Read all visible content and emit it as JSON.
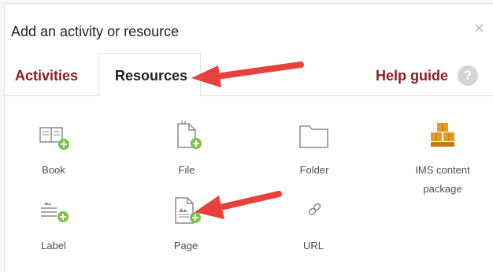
{
  "dialog": {
    "title": "Add an activity or resource",
    "close_symbol": "×"
  },
  "tabs": [
    {
      "label": "Activities",
      "active": false
    },
    {
      "label": "Resources",
      "active": true
    }
  ],
  "help": {
    "label": "Help guide",
    "icon_symbol": "?"
  },
  "resources": [
    {
      "label": "Book",
      "icon": "book-add-icon"
    },
    {
      "label": "File",
      "icon": "file-add-icon"
    },
    {
      "label": "Folder",
      "icon": "folder-icon"
    },
    {
      "label_line1": "IMS content",
      "label_line2": "package",
      "icon": "package-boxes-icon"
    },
    {
      "label": "Label",
      "icon": "label-add-icon"
    },
    {
      "label": "Page",
      "icon": "page-add-icon"
    },
    {
      "label": "URL",
      "icon": "link-icon"
    }
  ],
  "colors": {
    "tab_link": "#8a1e22",
    "add_badge": "#7cc243",
    "annotation_arrow": "#e8403a",
    "package_icon": "#e89a1c"
  }
}
